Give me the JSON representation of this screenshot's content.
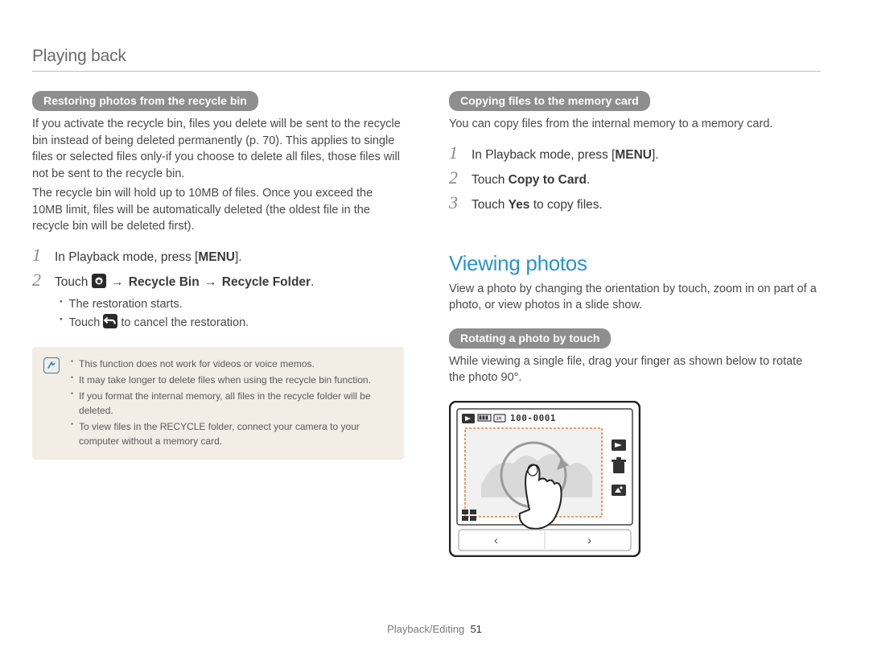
{
  "header": {
    "title": "Playing back"
  },
  "left": {
    "pill1": "Restoring photos from the recycle bin",
    "para1": "If you activate the recycle bin, files you delete will be sent to the recycle bin instead of being deleted permanently (p. 70). This applies to single files or selected files only-if you choose to delete all files, those files will not be sent to the recycle bin.",
    "para2": "The recycle bin will hold up to 10MB of files. Once you exceed the 10MB limit, files will be automatically deleted (the oldest file in the recycle bin will be deleted first).",
    "step1_pre": "In Playback mode, press [",
    "step1_bold": "MENU",
    "step1_post": "].",
    "step2_pre": "Touch ",
    "step2_mid1": " Recycle Bin ",
    "step2_mid2": " Recycle Folder",
    "step2_post": ".",
    "sub1": "The restoration starts.",
    "sub2_pre": "Touch ",
    "sub2_post": " to cancel the restoration.",
    "note": {
      "n1": "This function does not work for videos or voice memos.",
      "n2": "It may take longer to delete files when using the recycle bin function.",
      "n3": "If you format the internal memory, all files in the recycle folder will be deleted.",
      "n4": "To view files in the RECYCLE folder, connect your camera to your computer without a memory card."
    }
  },
  "right": {
    "pill1": "Copying files to the memory card",
    "para1": "You can copy files from the internal memory to a memory card.",
    "step1_pre": "In Playback mode, press [",
    "step1_bold": "MENU",
    "step1_post": "].",
    "step2_pre": "Touch ",
    "step2_bold": "Copy to Card",
    "step2_post": ".",
    "step3_pre": "Touch ",
    "step3_bold": "Yes",
    "step3_post": " to copy files.",
    "heading": "Viewing photos",
    "para2": "View a photo by changing the orientation by touch, zoom in on part of a photo, or view photos in a slide show.",
    "pill2": "Rotating a photo by touch",
    "para3": "While viewing a single file, drag your finger as shown below to rotate the photo 90°.",
    "screen_label": "100-0001"
  },
  "footer": {
    "section": "Playback/Editing",
    "page": "51"
  }
}
